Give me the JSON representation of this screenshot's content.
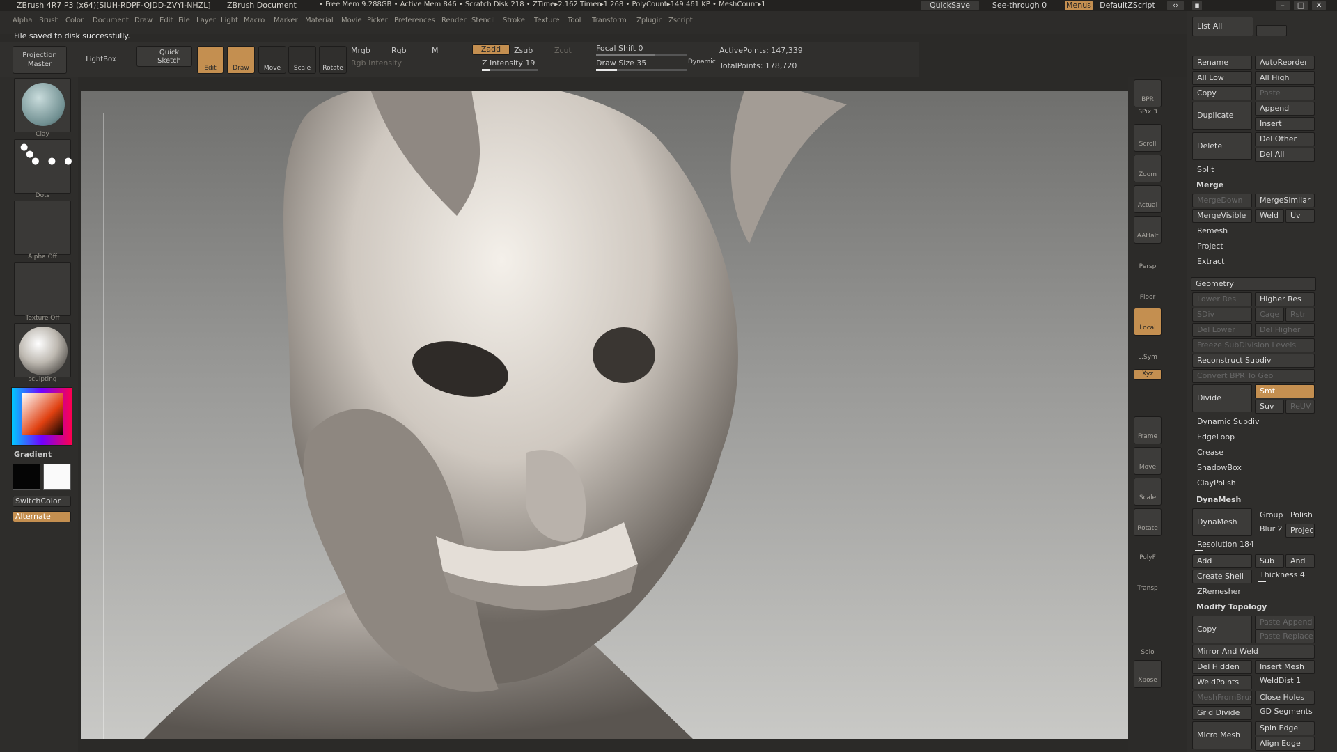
{
  "titlebar": {
    "app": "ZBrush 4R7 P3 (x64)[SIUH-RDPF-QJDD-ZVYI-NHZL]",
    "doc": "ZBrush Document",
    "mem": "• Free Mem 9.288GB • Active Mem 846 • Scratch Disk 218 • ZTime▸2.162 Timer▸1.268 • PolyCount▸149.461 KP • MeshCount▸1",
    "quicksave": "QuickSave",
    "seethrough": "See-through  0",
    "menus": "Menus",
    "script": "DefaultZScript"
  },
  "menubar": [
    "Alpha",
    "Brush",
    "Color",
    "Document",
    "Draw",
    "Edit",
    "File",
    "Layer",
    "Light",
    "Macro",
    "Marker",
    "Material",
    "Movie",
    "Picker",
    "Preferences",
    "Render",
    "Stencil",
    "Stroke",
    "Texture",
    "Tool",
    "Transform",
    "Zplugin",
    "Zscript"
  ],
  "status": "File saved to disk successfully.",
  "shelf": {
    "projection": "Projection Master",
    "lightbox": "LightBox",
    "quicksketch": "Quick Sketch",
    "edit": "Edit",
    "draw": "Draw",
    "move": "Move",
    "scale": "Scale",
    "rotate": "Rotate",
    "mrgb": "Mrgb",
    "rgb": "Rgb",
    "m": "M",
    "rgb_intensity": "Rgb Intensity",
    "zadd": "Zadd",
    "zsub": "Zsub",
    "zcut": "Zcut",
    "z_intensity": "Z Intensity 19",
    "focal_shift": "Focal Shift 0",
    "draw_size": "Draw Size 35",
    "dynamic": "Dynamic",
    "active_points": "ActivePoints: 147,339",
    "total_points": "TotalPoints: 178,720"
  },
  "lefttray": {
    "brush": "Clay",
    "stroke": "Dots",
    "alpha": "Alpha Off",
    "texture": "Texture Off",
    "material": "sculpting",
    "gradient": "Gradient",
    "switchcolor": "SwitchColor",
    "alternate": "Alternate"
  },
  "viewstrip": [
    "BPR",
    "SPix 3",
    "Scroll",
    "Zoom",
    "Actual",
    "AAHalf",
    "Persp",
    "Floor",
    "Local",
    "L.Sym",
    "Xyz",
    "Frame",
    "Move",
    "Scale",
    "Rotate",
    "PolyF",
    "Transp",
    "Solo",
    "Xpose"
  ],
  "rightpanel": {
    "listall": "List All",
    "rename": "Rename",
    "autoreorder": "AutoReorder",
    "alllow": "All Low",
    "allhigh": "All High",
    "copy": "Copy",
    "paste": "Paste",
    "duplicate": "Duplicate",
    "append": "Append",
    "insert": "Insert",
    "delete": "Delete",
    "delother": "Del Other",
    "delall": "Del All",
    "split": "Split",
    "merge": "Merge",
    "mergedown": "MergeDown",
    "mergesimilar": "MergeSimilar",
    "mergevisible": "MergeVisible",
    "weld": "Weld",
    "uv": "Uv",
    "remesh": "Remesh",
    "project": "Project",
    "extract": "Extract",
    "geometry": "Geometry",
    "lowerres": "Lower Res",
    "higherres": "Higher Res",
    "sdiv": "SDiv",
    "cage": "Cage",
    "rstr": "Rstr",
    "dellower": "Del Lower",
    "delhigher": "Del Higher",
    "freeze": "Freeze SubDivision Levels",
    "reconstruct": "Reconstruct Subdiv",
    "convertbpr": "Convert BPR To Geo",
    "divide": "Divide",
    "smt": "Smt",
    "suv": "Suv",
    "reuv": "ReUV",
    "dynsubdiv": "Dynamic Subdiv",
    "edgeloop": "EdgeLoop",
    "crease": "Crease",
    "shadowbox": "ShadowBox",
    "claypolish": "ClayPolish",
    "dynamesh_head": "DynaMesh",
    "dynamesh": "DynaMesh",
    "groups": "Groups",
    "polish": "Polish",
    "blur": "Blur 2",
    "projec": "Projec",
    "resolution": "Resolution 184",
    "add": "Add",
    "sub": "Sub",
    "and": "And",
    "createshell": "Create Shell",
    "thickness": "Thickness 4",
    "zremesher": "ZRemesher",
    "modtopo": "Modify Topology",
    "mcopy": "Copy",
    "pasteappend": "Paste Append",
    "pastereplace": "Paste Replace",
    "mirrorweld": "Mirror And Weld",
    "delhidden": "Del Hidden",
    "insertmesh": "Insert Mesh",
    "weldpoints": "WeldPoints",
    "welddist": "WeldDist 1",
    "meshfrombrush": "MeshFromBrush",
    "closeholes": "Close Holes",
    "griddivide": "Grid Divide",
    "gdsegments": "GD Segments",
    "spinedge": "Spin Edge",
    "micromesh": "Micro Mesh",
    "alignedge": "Align Edge"
  },
  "colors": {
    "accent": "#c48f50"
  }
}
